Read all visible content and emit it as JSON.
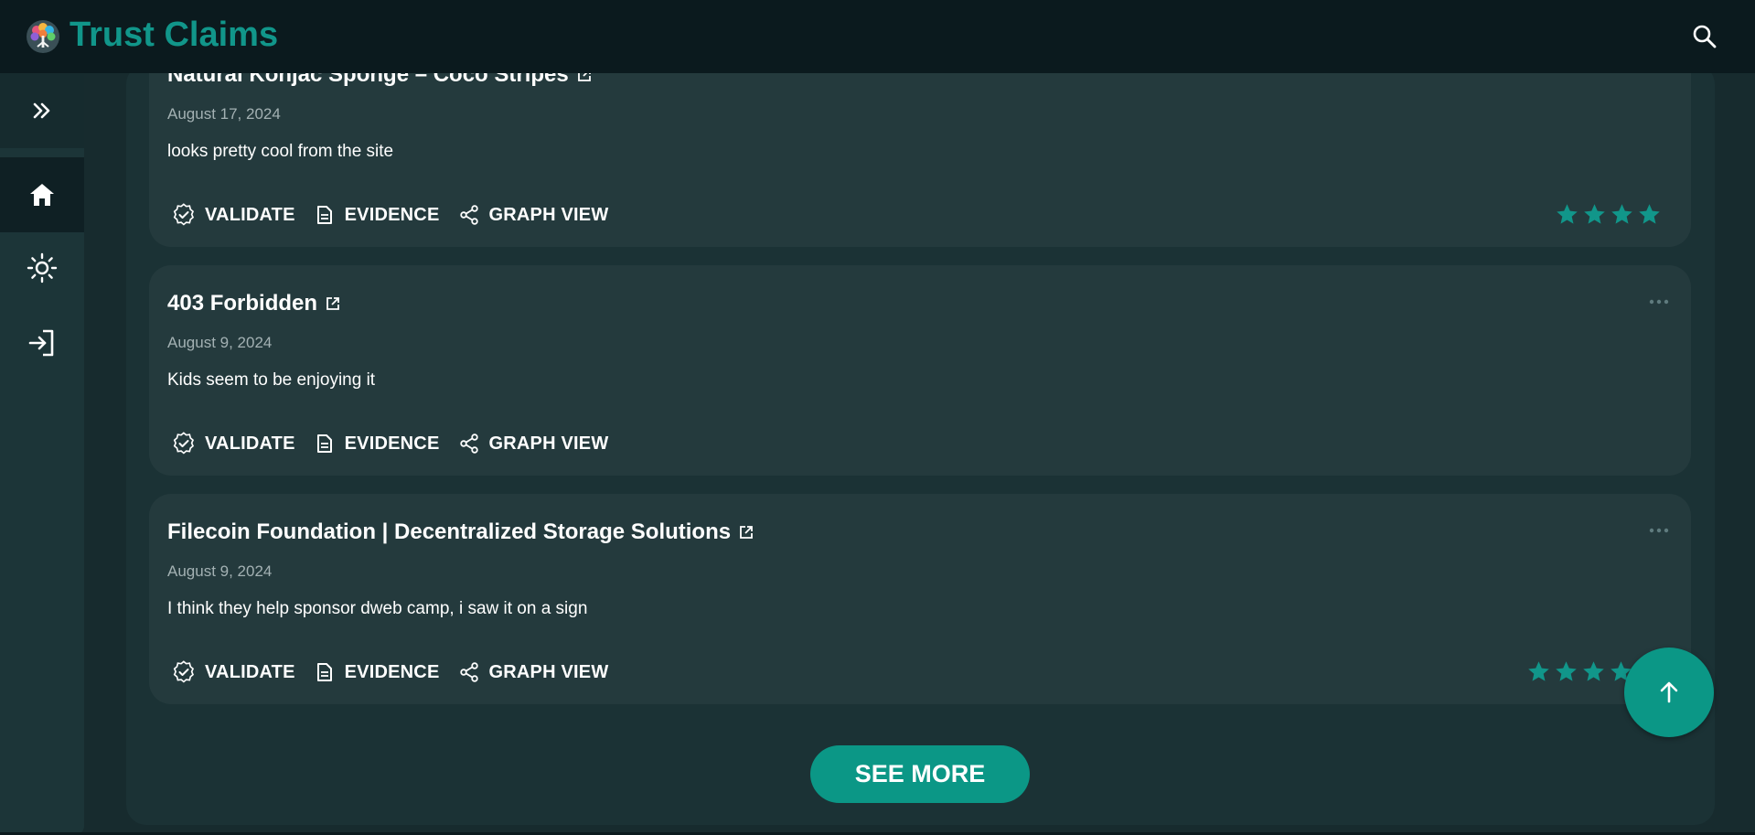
{
  "app": {
    "title": "Trust Claims",
    "accent_color": "#11968a",
    "logo_icon": "tree-logo-icon",
    "search_icon": "search-icon"
  },
  "sidebar": {
    "items": [
      {
        "name": "expand",
        "icon": "chevron-double-right-icon"
      },
      {
        "name": "home",
        "icon": "home-icon",
        "active": true
      },
      {
        "name": "theme",
        "icon": "sun-icon"
      },
      {
        "name": "login",
        "icon": "login-icon"
      }
    ]
  },
  "claims": [
    {
      "title": "Natural Konjac Sponge – Coco Stripes",
      "date": "August 17, 2024",
      "statement": "looks pretty cool from the site",
      "rating": 4
    },
    {
      "title": "403 Forbidden",
      "date": "August 9, 2024",
      "statement": "Kids seem to be enjoying it"
    },
    {
      "title": "Filecoin Foundation | Decentralized Storage Solutions",
      "date": "August 9, 2024",
      "statement": "I think they help sponsor dweb camp, i saw it on a sign",
      "rating": 4
    }
  ],
  "actions": {
    "validate": "VALIDATE",
    "evidence": "EVIDENCE",
    "graph_view": "GRAPH VIEW"
  },
  "see_more": "SEE MORE",
  "scroll_top_icon": "arrow-up-icon",
  "colors": {
    "background": "#172b2e",
    "card": "#243a3d",
    "star": "#11968a",
    "button": "#0b9786"
  }
}
